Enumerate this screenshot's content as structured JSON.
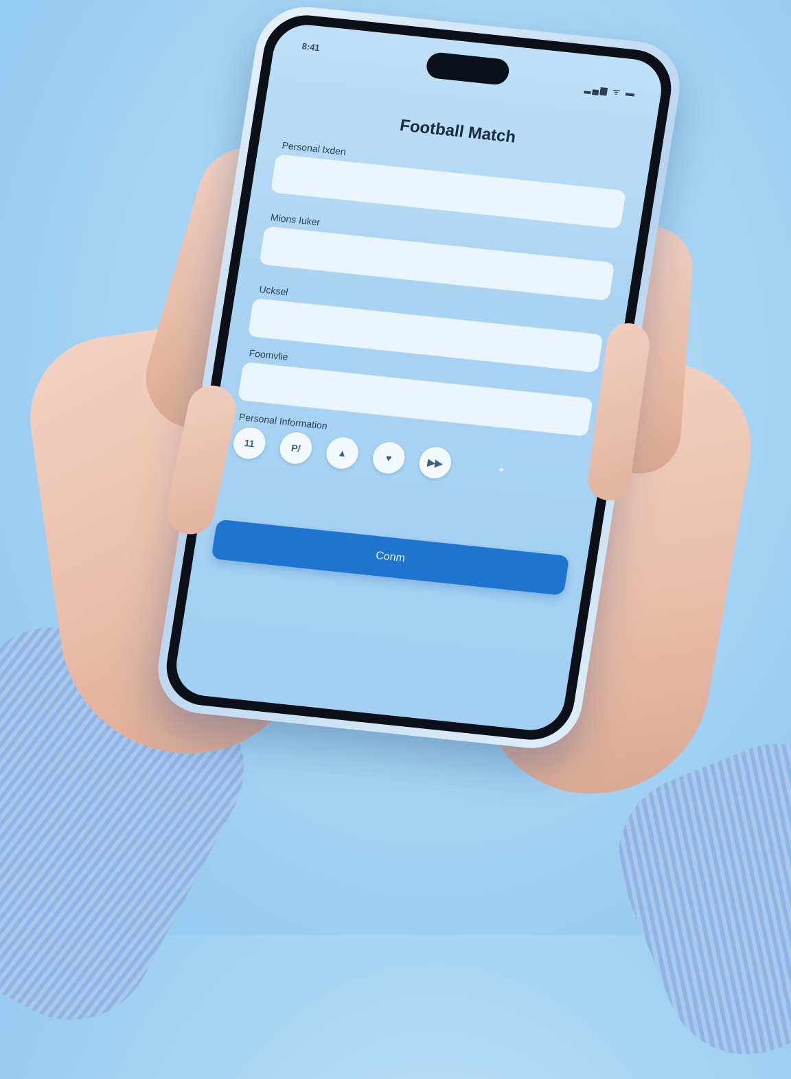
{
  "status_bar": {
    "time": "8:41",
    "icons_text": "▂▄▆ ᯤ ▬"
  },
  "app": {
    "title": "Football Match"
  },
  "form": {
    "fields": [
      {
        "label": "Personal Ixden",
        "value": ""
      },
      {
        "label": "Mions Iuker",
        "value": ""
      },
      {
        "label": "Ucksel",
        "value": ""
      },
      {
        "label": "Foomvlie",
        "value": ""
      }
    ],
    "section_label": "Personal Information",
    "icon_buttons": [
      {
        "glyph": "11",
        "icon": "number-icon"
      },
      {
        "glyph": "P/",
        "icon": "profile-icon"
      },
      {
        "glyph": "▲",
        "icon": "bell-icon"
      },
      {
        "glyph": "♥",
        "icon": "heart-icon"
      },
      {
        "glyph": "▶▶",
        "icon": "forward-icon"
      }
    ],
    "sparkle_glyph": "✦",
    "submit_label": "Conm"
  },
  "colors": {
    "accent": "#1e74cf",
    "screen_bg": "#a9d3f3",
    "field_bg": "#eaf5fd"
  }
}
